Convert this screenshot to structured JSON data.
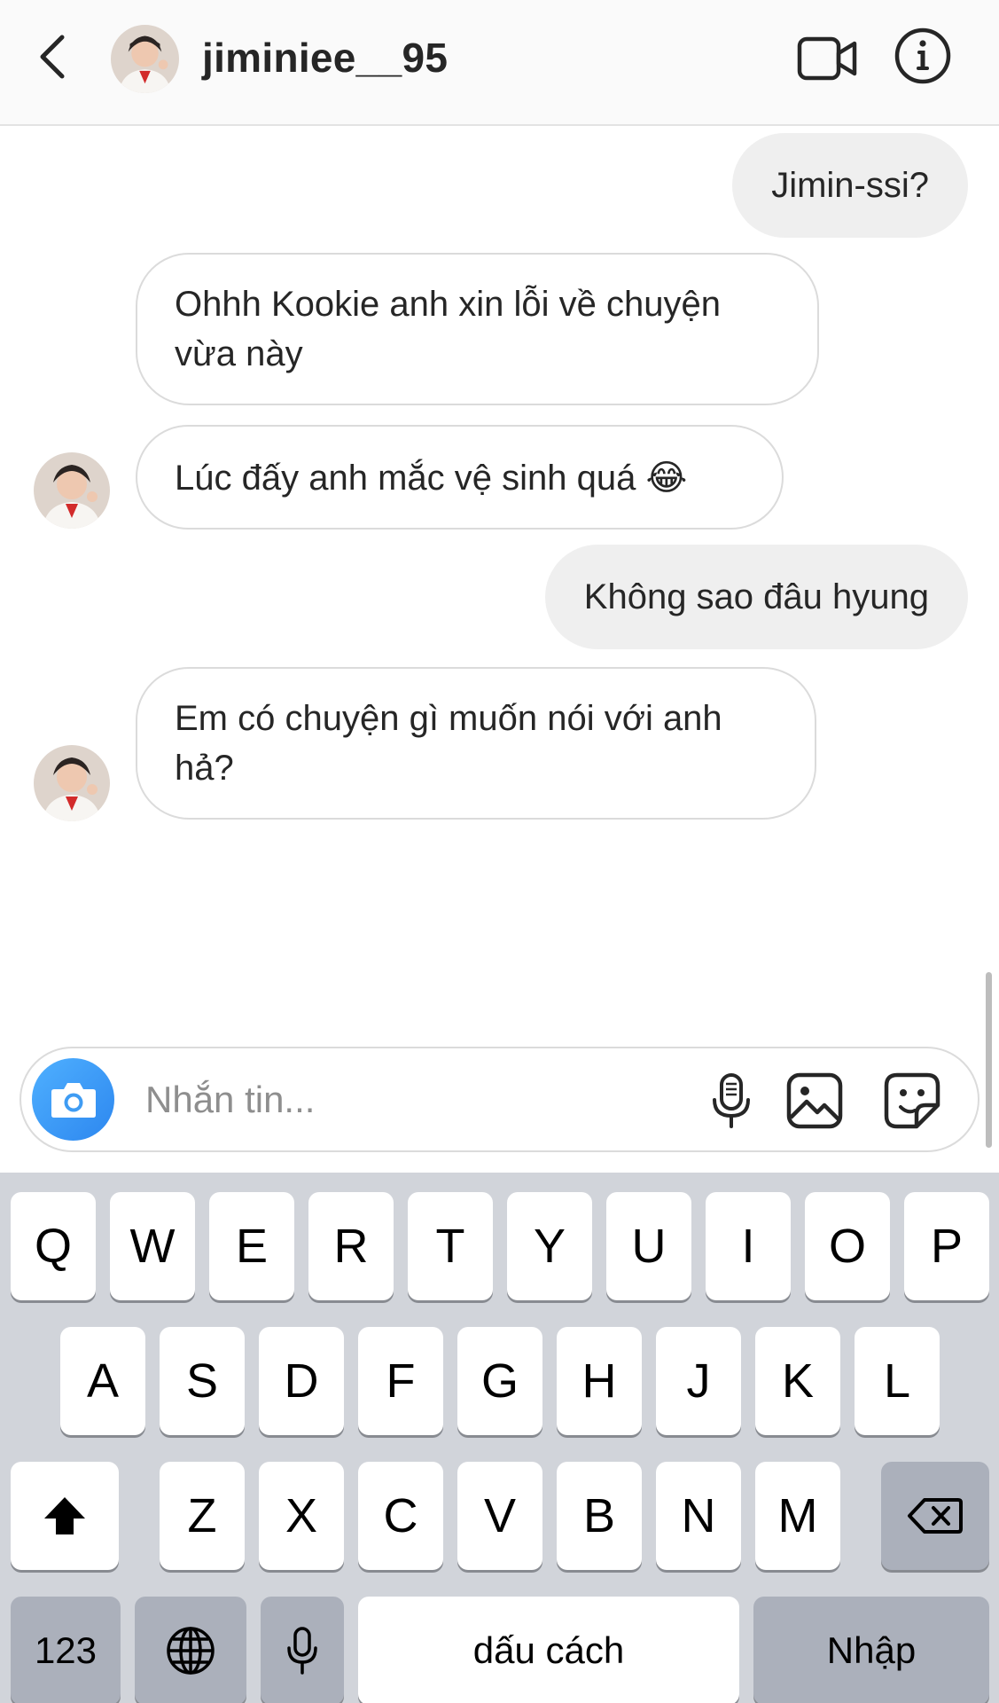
{
  "header": {
    "username": "jiminiee__95",
    "icons": {
      "back": "chevron-left-icon",
      "video": "video-camera-icon",
      "info": "info-icon"
    }
  },
  "messages": [
    {
      "side": "out",
      "text": "Jimin-ssi?"
    },
    {
      "side": "in",
      "text": "Ohhh Kookie anh xin lỗi về chuyện vừa này"
    },
    {
      "side": "in",
      "text": "Lúc đấy anh mắc vệ sinh quá 😂"
    },
    {
      "side": "out",
      "text": "Không sao đâu hyung"
    },
    {
      "side": "in",
      "text": "Em có chuyện gì muốn nói với anh hả?"
    }
  ],
  "composer": {
    "placeholder": "Nhắn tin...",
    "icons": {
      "camera": "camera-icon",
      "mic": "microphone-icon",
      "gallery": "image-icon",
      "sticker": "sticker-icon"
    }
  },
  "keyboard": {
    "row1": [
      "Q",
      "W",
      "E",
      "R",
      "T",
      "Y",
      "U",
      "I",
      "O",
      "P"
    ],
    "row2": [
      "A",
      "S",
      "D",
      "F",
      "G",
      "H",
      "J",
      "K",
      "L"
    ],
    "row3": [
      "Z",
      "X",
      "C",
      "V",
      "B",
      "N",
      "M"
    ],
    "numbers_label": "123",
    "space_label": "dấu cách",
    "return_label": "Nhập",
    "icons": {
      "shift": "shift-icon",
      "delete": "delete-icon",
      "globe": "globe-icon",
      "dictation": "microphone-icon"
    }
  },
  "colors": {
    "camera_button": "#3897f0",
    "outgoing_bubble": "#efefef",
    "keyboard_bg": "#d1d4da"
  }
}
